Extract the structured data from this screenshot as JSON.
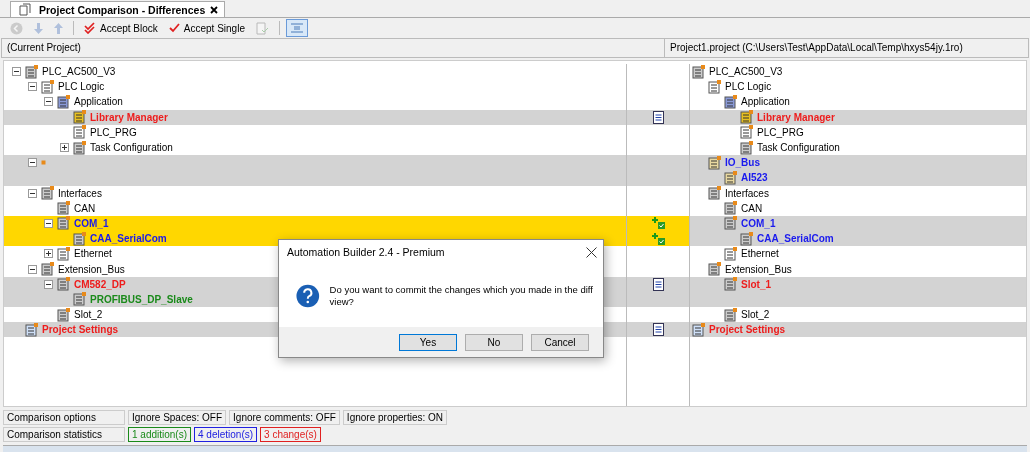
{
  "tab": {
    "title": "Project Comparison - Differences",
    "selected": true
  },
  "toolbar": [
    {
      "kind": "back",
      "disabled": true
    },
    {
      "kind": "down",
      "disabled": true
    },
    {
      "kind": "up",
      "disabled": true
    },
    {
      "kind": "accept-block",
      "label": "Accept Block",
      "disabled": false
    },
    {
      "kind": "accept-single",
      "label": "Accept Single",
      "disabled": false
    },
    {
      "kind": "accept-doc",
      "disabled": true
    },
    {
      "kind": "toggle",
      "disabled": false,
      "on": true
    }
  ],
  "header": {
    "left": "(Current Project)",
    "right": "Project1.project (C:\\Users\\Test\\AppData\\Local\\Temp\\hxys54jy.1ro)"
  },
  "left_tree": [
    {
      "label": "PLC_AC500_V3",
      "kind": "controller",
      "expanded": true,
      "children": [
        {
          "label": "PLC Logic",
          "kind": "logic",
          "expanded": true,
          "children": [
            {
              "label": "Application",
              "kind": "app",
              "expanded": true,
              "children": [
                {
                  "label": "Library Manager",
                  "kind": "library",
                  "color": "#ee1c1c"
                },
                {
                  "label": "PLC_PRG",
                  "kind": "program"
                },
                {
                  "label": "Task Configuration",
                  "kind": "task",
                  "expanded": false
                }
              ]
            }
          ]
        },
        {
          "kind": "node",
          "expanded": true,
          "children": [
            {
              "kind": "gap"
            }
          ]
        },
        {
          "label": "Interfaces",
          "kind": "interfaces",
          "expanded": true,
          "children": [
            {
              "label": "CAN",
              "kind": "slot"
            },
            {
              "label": "COM_1",
              "kind": "port",
              "color": "#1a1aee",
              "expanded": true,
              "children": [
                {
                  "label": "CAA_SerialCom",
                  "kind": "serial",
                  "color": "#1a1aee"
                }
              ]
            },
            {
              "label": "Ethernet",
              "kind": "ethernet",
              "expanded": false
            }
          ]
        },
        {
          "label": "Extension_Bus",
          "kind": "module",
          "expanded": true,
          "children": [
            {
              "label": "CM582_DP",
              "kind": "module",
              "color": "#ee1c1c",
              "expanded": true,
              "children": [
                {
                  "label": "PROFIBUS_DP_Slave",
                  "kind": "module",
                  "color": "#1a8a1a"
                }
              ]
            },
            {
              "label": "Slot_2",
              "kind": "slot"
            }
          ]
        }
      ]
    },
    {
      "label": "Project Settings",
      "kind": "settings",
      "color": "#ee1c1c"
    }
  ],
  "right_tree": [
    {
      "label": "PLC_AC500_V3",
      "kind": "controller",
      "children": [
        {
          "label": "PLC Logic",
          "kind": "logic",
          "children": [
            {
              "label": "Application",
              "kind": "app",
              "children": [
                {
                  "label": "Library Manager",
                  "kind": "library",
                  "color": "#ee1c1c"
                },
                {
                  "label": "PLC_PRG",
                  "kind": "program"
                },
                {
                  "label": "Task Configuration",
                  "kind": "task"
                }
              ]
            }
          ]
        },
        {
          "label": "IO_Bus",
          "kind": "bus",
          "color": "#1a1aee",
          "children": [
            {
              "label": "AI523",
              "kind": "bus",
              "color": "#1a1aee"
            }
          ]
        },
        {
          "label": "Interfaces",
          "kind": "interfaces",
          "children": [
            {
              "label": "CAN",
              "kind": "slot"
            },
            {
              "label": "COM_1",
              "kind": "port",
              "color": "#1a1aee",
              "children": [
                {
                  "label": "CAA_SerialCom",
                  "kind": "serial",
                  "color": "#1a1aee"
                }
              ]
            },
            {
              "label": "Ethernet",
              "kind": "ethernet"
            }
          ]
        },
        {
          "label": "Extension_Bus",
          "kind": "module",
          "children": [
            {
              "label": "Slot_1",
              "kind": "slot",
              "color": "#ee1c1c",
              "children": [
                {
                  "kind": "gap"
                }
              ]
            },
            {
              "label": "Slot_2",
              "kind": "slot"
            }
          ]
        }
      ]
    },
    {
      "label": "Project Settings",
      "kind": "settings",
      "color": "#ee1c1c"
    }
  ],
  "diff_rows": [
    {
      "kind": "same",
      "selected": false
    },
    {
      "kind": "same",
      "selected": false
    },
    {
      "kind": "same",
      "selected": false
    },
    {
      "kind": "changed",
      "selected": false
    },
    {
      "kind": "same",
      "selected": false
    },
    {
      "kind": "same",
      "selected": false
    },
    {
      "kind": "deleted",
      "selected": false
    },
    {
      "kind": "deleted",
      "selected": false
    },
    {
      "kind": "same",
      "selected": false
    },
    {
      "kind": "same",
      "selected": false
    },
    {
      "kind": "accepted",
      "selected": true
    },
    {
      "kind": "accepted",
      "selected": true
    },
    {
      "kind": "same",
      "selected": false
    },
    {
      "kind": "same",
      "selected": false
    },
    {
      "kind": "changed",
      "selected": false
    },
    {
      "kind": "added",
      "selected": false
    },
    {
      "kind": "same",
      "selected": false
    },
    {
      "kind": "changed",
      "selected": false
    }
  ],
  "footer": [
    {
      "label": "Comparison options",
      "values": [
        {
          "text": "Ignore Spaces: OFF"
        },
        {
          "text": "Ignore comments: OFF"
        },
        {
          "text": "Ignore properties: ON"
        }
      ]
    },
    {
      "label": "Comparison statistics",
      "values": [
        {
          "text": "1 addition(s)",
          "color": "#1a8a1a"
        },
        {
          "text": "4 deletion(s)",
          "color": "#2020e0"
        },
        {
          "text": "3 change(s)",
          "color": "#e02020"
        }
      ]
    }
  ],
  "dialog": {
    "title": "Automation Builder 2.4 - Premium",
    "message": "Do you want to commit the changes which you made in the diff view?",
    "buttons": [
      {
        "label": "Yes",
        "selected": true
      },
      {
        "label": "No",
        "selected": false
      },
      {
        "label": "Cancel",
        "selected": false
      }
    ]
  }
}
